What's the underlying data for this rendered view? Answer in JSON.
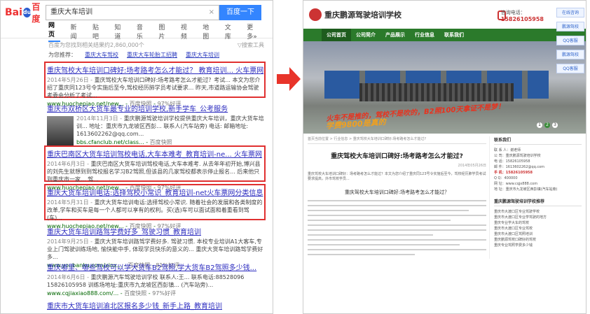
{
  "baidu": {
    "logo_latin": "Bai",
    "logo_paw": "du",
    "logo_cn": "百度",
    "query": "重庆大车培训",
    "clear": "×",
    "search_button": "百度一下",
    "tabs": [
      "网页",
      "新闻",
      "贴吧",
      "知道",
      "音乐",
      "图片",
      "视频",
      "地图",
      "文库",
      "更多»"
    ],
    "info_left": "百度为您找到相关结果约2,860,000个",
    "info_right": "▽搜索工具",
    "related_label": "为您推荐：",
    "related": [
      "重庆大车驾校",
      "重庆大车轮胎工招聘",
      "重庆大车培训"
    ],
    "results": [
      {
        "title": "重庆驾校大车培训口碑好:场考路考怎么才能过？ 教育培训... 火车票网",
        "desc_date": "2014年5月26日 -",
        "desc": "重庆驾校大车培训口碑好:场考路考怎么才能过？考试... 本文为您介绍了重庆同123号令实施后至今,驾校经历肺学员考试要求... 昨天,市道路运输协会驾驶考委会分析了考试...",
        "url": "www.huochepiao.net/new...",
        "cache": "百度快照",
        "score": "97%好评"
      },
      {
        "title": "重庆市双桥区大货车最专业的培训学校,新手学车_公考服务",
        "desc_date": "2014年11月3日 -",
        "desc": "重庆鹏源驾驶培训学校提供重庆大车培训，重庆大货车培训... 地址：重庆市九龙坡区西彭... 联系人(汽车站旁) 电话: 邮箱地址: 1613602262@qq.com...",
        "url": "bbs.cfanclub.net/class...",
        "cache": "百度快照",
        "score": ""
      },
      {
        "title": "重庆巴南区大货车培训驾校电话,大车本难考_教育培训-ne... 火车票网",
        "desc_date": "2014年6月3日 -",
        "desc": "重庆巴南区大货车培训驾校电话,大车本难考. 从去年年初开始,博兴县的刘先生就想到到驾校报名学习B2驾照,但该县的几家驾校都表示停止报名... 后来他只到重庆市一家... 驾...",
        "url": "www.huochepiao.net/new...",
        "cache": "百度快照",
        "score": "97%好评"
      },
      {
        "title": "重庆大货车培训电话:选择驾校小常识_教育培训-net火车票网分类信息",
        "desc_date": "2014年5月31日 -",
        "desc": "重庆大货车培训电话:选择驾校小常识. 随着社会的发展和各类制度的改革,学车和买车是每一个人都可以享有的权利。买(选)车可以面试面和着重看到驾(车)...",
        "url": "www.huochepiao.net/new...",
        "cache": "百度快照",
        "score": "97%好评"
      },
      {
        "title": "重庆大货车培训路驾学费好多_驾驶习惯_教育培训",
        "desc_date": "2014年9月25日 -",
        "desc": "重庆大货车培训路驾学费好多. 驾驶习惯. 本校专业培训A1大客车,专业上门驾驶训练场地, 愉快能中手, 体现学员快乐的意义的... 重庆大货车培训路驾学费好多...",
        "url": "www.youbanku.com/xinx...",
        "cache": "百度快照",
        "score": "81%好评"
      },
      {
        "title": "重庆哪里、哪些驾校可以学大货车B2驾照,学大货车B2驾照多少钱...",
        "desc_date": "2014年6月6日 -",
        "desc": "重庆鹏源汽车驾驶培训学校 联系人:王... 联系电话:88528096 15826105958 训练场地址:重庆市九龙坡区西彭镇... (汽车站旁)...",
        "url": "www.cqjiaxiao888.com/...",
        "cache": "百度快照",
        "score": "97%好评"
      },
      {
        "title": "重庆市大货车培训渝北区报名多少钱_新手上路_教育培训",
        "desc_date": "",
        "desc": "",
        "url": "",
        "cache": "",
        "score": ""
      }
    ]
  },
  "site": {
    "name": "重庆鹏源驾驶培训学校",
    "phone_label": "咨询电话：",
    "phone": "15826105958",
    "nav": [
      "公司首页",
      "公司简介",
      "产品展示",
      "行业信息",
      "联系我们"
    ],
    "slogan1": "火车不是推的，驾校不是吹的，B2照100天拿证不是梦！",
    "slogan2": "学费9800是真的",
    "slides": [
      "1",
      "2",
      "3"
    ],
    "side_buttons": [
      "在线咨询",
      "鹏源驾校",
      "QQ客服",
      "鹏源驾校",
      "QQ客服"
    ],
    "crumb": "首页当前位置 > 行业信息 > 重庆驾校大车培训口碑好:场考路考怎么才能过?",
    "article_title": "重庆驾校大车培训口碑好:场考路考怎么才能过?",
    "article_date": "2014年05月26日",
    "intro": "重庆驾校大车培训口碑好：场考路考怎么才能过？本文为您介绍了重庆同123号令实施后至今，驾校经历肺学员考试要求提高，外市驾校学员...",
    "sub_title": "重庆驾校大车培训口碑好:场考路考怎么才能过？",
    "aside_heading": "联系我们",
    "aside_lines": [
      "联 系 人：谢老师",
      "公 司：重庆鹏源驾驶培训学校",
      "电 话：15826105958",
      "邮 件：1613602262@qq.com",
      "手 机：15826105958",
      "Q Q：400000",
      "网 址：www.cqjx888.com",
      "地 址：重庆市九龙坡区西彭镇(汽车站旁)"
    ],
    "aside_heading2": "重庆鹏源驾驶培训学校推荐",
    "aside_links": [
      "重庆市大渡口区专业驾驶学校",
      "重庆市大渡口区专业学驾驶的地方",
      "重庆专业学大车的驾校",
      "重庆市大渡口区专业驾校",
      "重庆市大渡口区驾照培训",
      "重庆鹏源驾校口碑好的驾校",
      "重庆专业驾照学费多少钱"
    ]
  }
}
